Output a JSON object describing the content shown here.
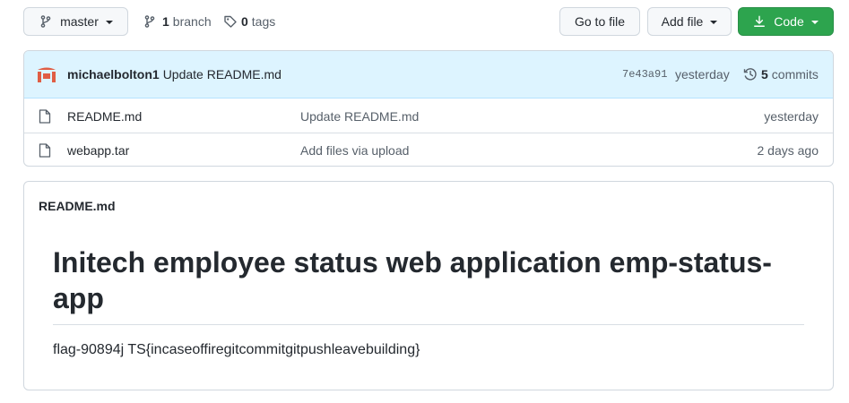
{
  "toolbar": {
    "branch_name": "master",
    "branch_count": "1",
    "branch_label": "branch",
    "tag_count": "0",
    "tag_label": "tags",
    "go_to_file": "Go to file",
    "add_file": "Add file",
    "code": "Code"
  },
  "latest_commit": {
    "author": "michaelbolton1",
    "message": "Update README.md",
    "hash": "7e43a91",
    "time": "yesterday",
    "commit_count": "5",
    "commit_label": "commits"
  },
  "files": [
    {
      "name": "README.md",
      "message": "Update README.md",
      "time": "yesterday",
      "icon": "file-icon"
    },
    {
      "name": "webapp.tar",
      "message": "Add files via upload",
      "time": "2 days ago",
      "icon": "file-icon"
    }
  ],
  "readme": {
    "file_label": "README.md",
    "heading": "Initech employee status web application emp-status-app",
    "body": "flag-90894j TS{incaseoffiregitcommitgitpushleavebuilding}"
  },
  "colors": {
    "primary_green": "#2da44e",
    "commit_bar_bg": "#ddf4ff",
    "avatar_red": "#e05d44"
  }
}
